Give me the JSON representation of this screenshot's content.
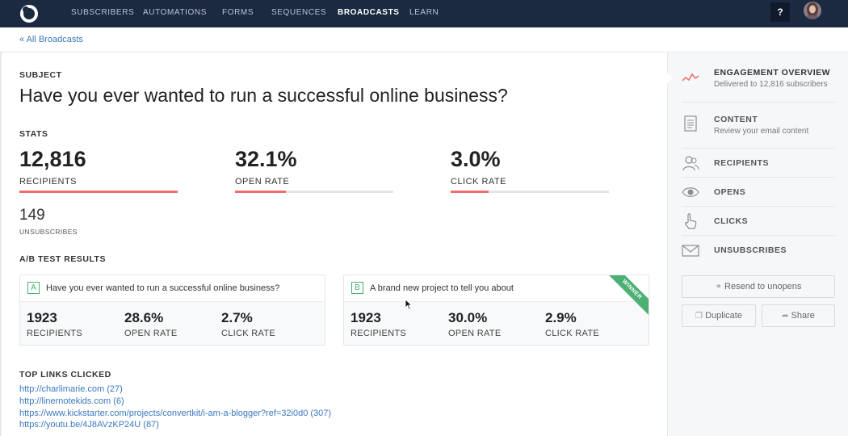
{
  "nav": {
    "items": [
      "SUBSCRIBERS",
      "AUTOMATIONS",
      "FORMS",
      "SEQUENCES",
      "BROADCASTS",
      "LEARN"
    ],
    "active": "BROADCASTS",
    "help": "?"
  },
  "breadcrumb": "« All Broadcasts",
  "subject": {
    "label": "SUBJECT",
    "text": "Have you ever wanted to run a successful online business?"
  },
  "stats": {
    "label": "STATS",
    "recipients": {
      "value": "12,816",
      "label": "RECIPIENTS",
      "fill": 100
    },
    "open_rate": {
      "value": "32.1%",
      "label": "OPEN RATE",
      "fill": 32.1
    },
    "click_rate": {
      "value": "3.0%",
      "label": "CLICK RATE",
      "fill": 24
    },
    "unsubscribes": {
      "value": "149",
      "label": "UNSUBSCRIBES"
    }
  },
  "ab_test": {
    "label": "A/B TEST RESULTS",
    "variants": [
      {
        "letter": "A",
        "subject": "Have you ever wanted to run a successful online business?",
        "recipients": "1923",
        "recipients_label": "RECIPIENTS",
        "open_rate": "28.6%",
        "open_label": "OPEN RATE",
        "click_rate": "2.7%",
        "click_label": "CLICK RATE"
      },
      {
        "letter": "B",
        "subject": "A brand new project to tell you about",
        "recipients": "1923",
        "recipients_label": "RECIPIENTS",
        "open_rate": "30.0%",
        "open_label": "OPEN RATE",
        "click_rate": "2.9%",
        "click_label": "CLICK RATE",
        "badge": "WINNER"
      }
    ]
  },
  "top_links": {
    "label": "TOP LINKS CLICKED",
    "items": [
      "http://charlimarie.com (27)",
      "http://linernotekids.com (6)",
      "https://www.kickstarter.com/projects/convertkit/i-am-a-blogger?ref=32i0d0 (307)",
      "https://youtu.be/4J8AVzKP24U (87)"
    ]
  },
  "sidebar": {
    "items": [
      {
        "title": "ENGAGEMENT OVERVIEW",
        "desc": "Delivered to 12,816 subscribers"
      },
      {
        "title": "CONTENT",
        "desc": "Review your email content"
      },
      {
        "title": "RECIPIENTS"
      },
      {
        "title": "OPENS"
      },
      {
        "title": "CLICKS"
      },
      {
        "title": "UNSUBSCRIBES"
      }
    ],
    "resend": "Resend to unopens",
    "duplicate": "Duplicate",
    "share": "Share"
  },
  "colors": {
    "nav_bg": "#1c2a41",
    "accent_red": "#f26b6b",
    "winner_green": "#4caf73",
    "link_blue": "#3a78c0"
  }
}
